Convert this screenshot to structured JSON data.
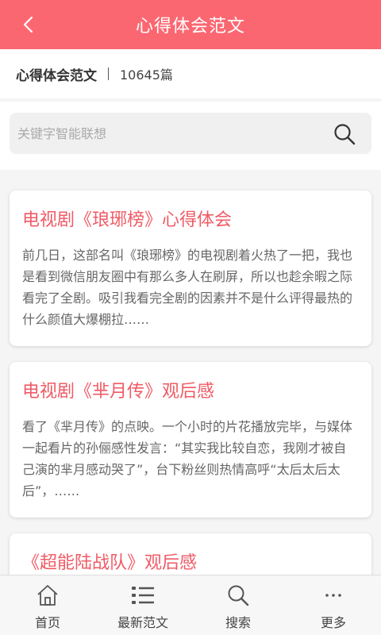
{
  "header": {
    "title": "心得体会范文",
    "back_icon": "chevron-left-icon",
    "bg_color": "#fb6771"
  },
  "subheader": {
    "name": "心得体会范文",
    "count": "10645篇"
  },
  "search": {
    "placeholder": "关键字智能联想",
    "value": ""
  },
  "articles": [
    {
      "title": "电视剧《琅琊榜》心得体会",
      "excerpt": "前几日，这部名叫《琅琊榜》的电视剧着火热了一把，我也是看到微信朋友圈中有那么多人在刷屏，所以也趁余暇之际看完了全剧。吸引我看完全剧的因素并不是什么评得最热的什么颜值大爆棚拉……"
    },
    {
      "title": "电视剧《芈月传》观后感",
      "excerpt": "看了《芈月传》的点映。一个小时的片花播放完毕，与媒体一起看片的孙俪感性发言：“其实我比较自恋，我刚才被自己演的芈月感动哭了”，台下粉丝则热情高呼“太后太后太后”，……"
    },
    {
      "title": "《超能陆战队》观后感",
      "excerpt": ""
    }
  ],
  "tabbar": {
    "items": [
      {
        "label": "首页",
        "icon": "home-icon"
      },
      {
        "label": "最新范文",
        "icon": "list-icon"
      },
      {
        "label": "搜索",
        "icon": "search-icon"
      },
      {
        "label": "更多",
        "icon": "more-icon"
      }
    ]
  }
}
